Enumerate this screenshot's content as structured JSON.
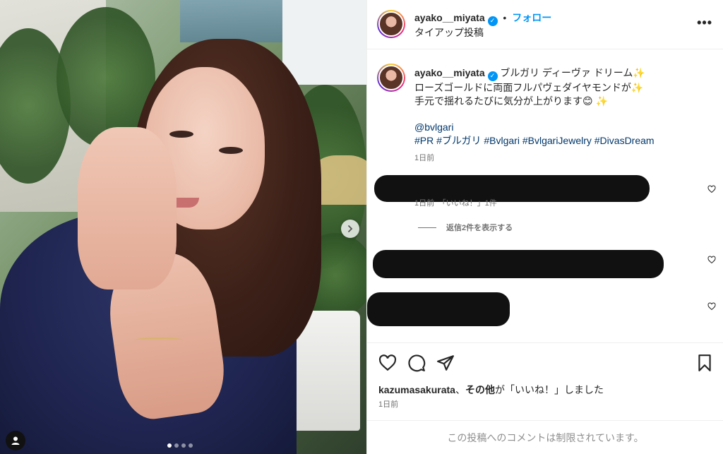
{
  "post": {
    "username": "ayako__miyata",
    "follow_label": "フォロー",
    "subtitle": "タイアップ投稿",
    "separator": "•"
  },
  "caption": {
    "username": "ayako__miyata",
    "line1": "ブルガリ ディーヴァ ドリーム✨",
    "line2": "ローズゴールドに両面フルパヴェダイヤモンドが✨",
    "line3": "手元で揺れるたびに気分が上がります😊 ✨",
    "mention": "@bvlgari",
    "hashtags": "#PR #ブルガリ #Bvlgari #BvlgariJewelry #DivasDream",
    "time": "1日前"
  },
  "comments": {
    "c1_meta": "1日前　「いいね！」1件",
    "c1_replies": "返信2件を表示する"
  },
  "likes": {
    "liker": "kazumasakurata",
    "text_mid": "、",
    "others": "その他",
    "text_end": "が「いいね！」しました",
    "time": "1日前"
  },
  "footer": {
    "text": "この投稿へのコメントは制限されています。"
  },
  "icons": {
    "more": "more-horizontal-icon",
    "like": "heart-icon",
    "comment": "comment-icon",
    "share": "share-icon",
    "save": "bookmark-icon"
  },
  "colors": {
    "accent": "#0095f6",
    "link": "#00376b",
    "muted": "#737373"
  }
}
